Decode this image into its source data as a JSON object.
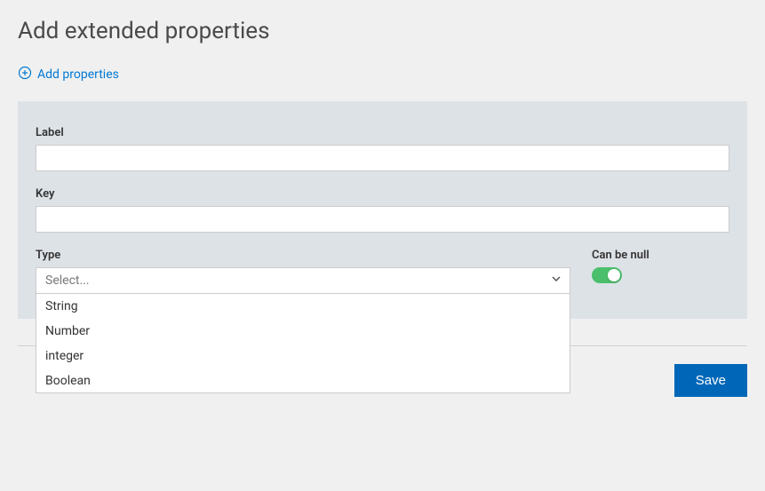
{
  "header": {
    "title": "Add extended properties",
    "add_link": "Add properties"
  },
  "form": {
    "label_field": {
      "label": "Label",
      "value": ""
    },
    "key_field": {
      "label": "Key",
      "value": ""
    },
    "type_field": {
      "label": "Type",
      "placeholder": "Select...",
      "options": [
        "String",
        "Number",
        "integer",
        "Boolean"
      ]
    },
    "null_field": {
      "label": "Can be null",
      "enabled": true
    }
  },
  "footer": {
    "save_label": "Save"
  }
}
